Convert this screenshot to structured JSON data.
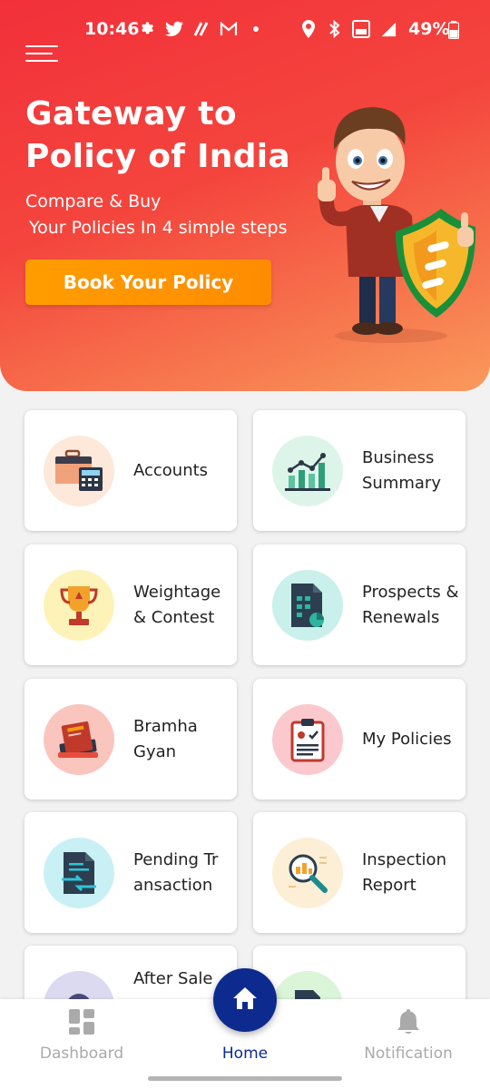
{
  "status_bar": {
    "time": "10:46",
    "battery": "49%"
  },
  "hero": {
    "title": "Gateway to Policy of India",
    "subtitle_line1": "Compare & Buy",
    "subtitle_line2": "Your Policies In 4 simple steps",
    "cta_label": "Book Your Policy",
    "colors": {
      "gradient_start": "#f2303a",
      "gradient_end": "#fa9a5c",
      "cta": "#ff9300"
    }
  },
  "tiles": [
    {
      "label": "Accounts",
      "icon": "accounts-icon",
      "icon_bg": "#fde8da"
    },
    {
      "label": "Business Summary",
      "icon": "business-summary-icon",
      "icon_bg": "#ddf5e8"
    },
    {
      "label": "Weightage & Contest",
      "icon": "trophy-icon",
      "icon_bg": "#fdf3b8"
    },
    {
      "label": "Prospects & Renewals",
      "icon": "prospects-icon",
      "icon_bg": "#c9f0ea"
    },
    {
      "label": "Bramha Gyan",
      "icon": "books-icon",
      "icon_bg": "#f9c5bd"
    },
    {
      "label": "My Policies",
      "icon": "policy-document-icon",
      "icon_bg": "#fbc9cd"
    },
    {
      "label": "Pending Transaction",
      "label_line1": "Pending Tr",
      "label_line2": "ansaction",
      "icon": "pending-transaction-icon",
      "icon_bg": "#c9f0f5"
    },
    {
      "label": "Inspection Report",
      "icon": "inspection-icon",
      "icon_bg": "#fcefd6"
    },
    {
      "label": "After Sale",
      "partial_label": "After Sale",
      "icon": "after-sale-icon",
      "icon_bg": "#dcdaf0"
    },
    {
      "label": "",
      "icon": "document-icon",
      "icon_bg": "#daf5d8"
    }
  ],
  "bottom_nav": {
    "items": [
      {
        "label": "Dashboard",
        "icon": "dashboard-icon",
        "active": false
      },
      {
        "label": "Home",
        "icon": "home-icon",
        "active": true
      },
      {
        "label": "Notification",
        "icon": "bell-icon",
        "active": false
      }
    ],
    "colors": {
      "active": "#0d2a8f",
      "inactive": "#aaaaaa"
    }
  }
}
